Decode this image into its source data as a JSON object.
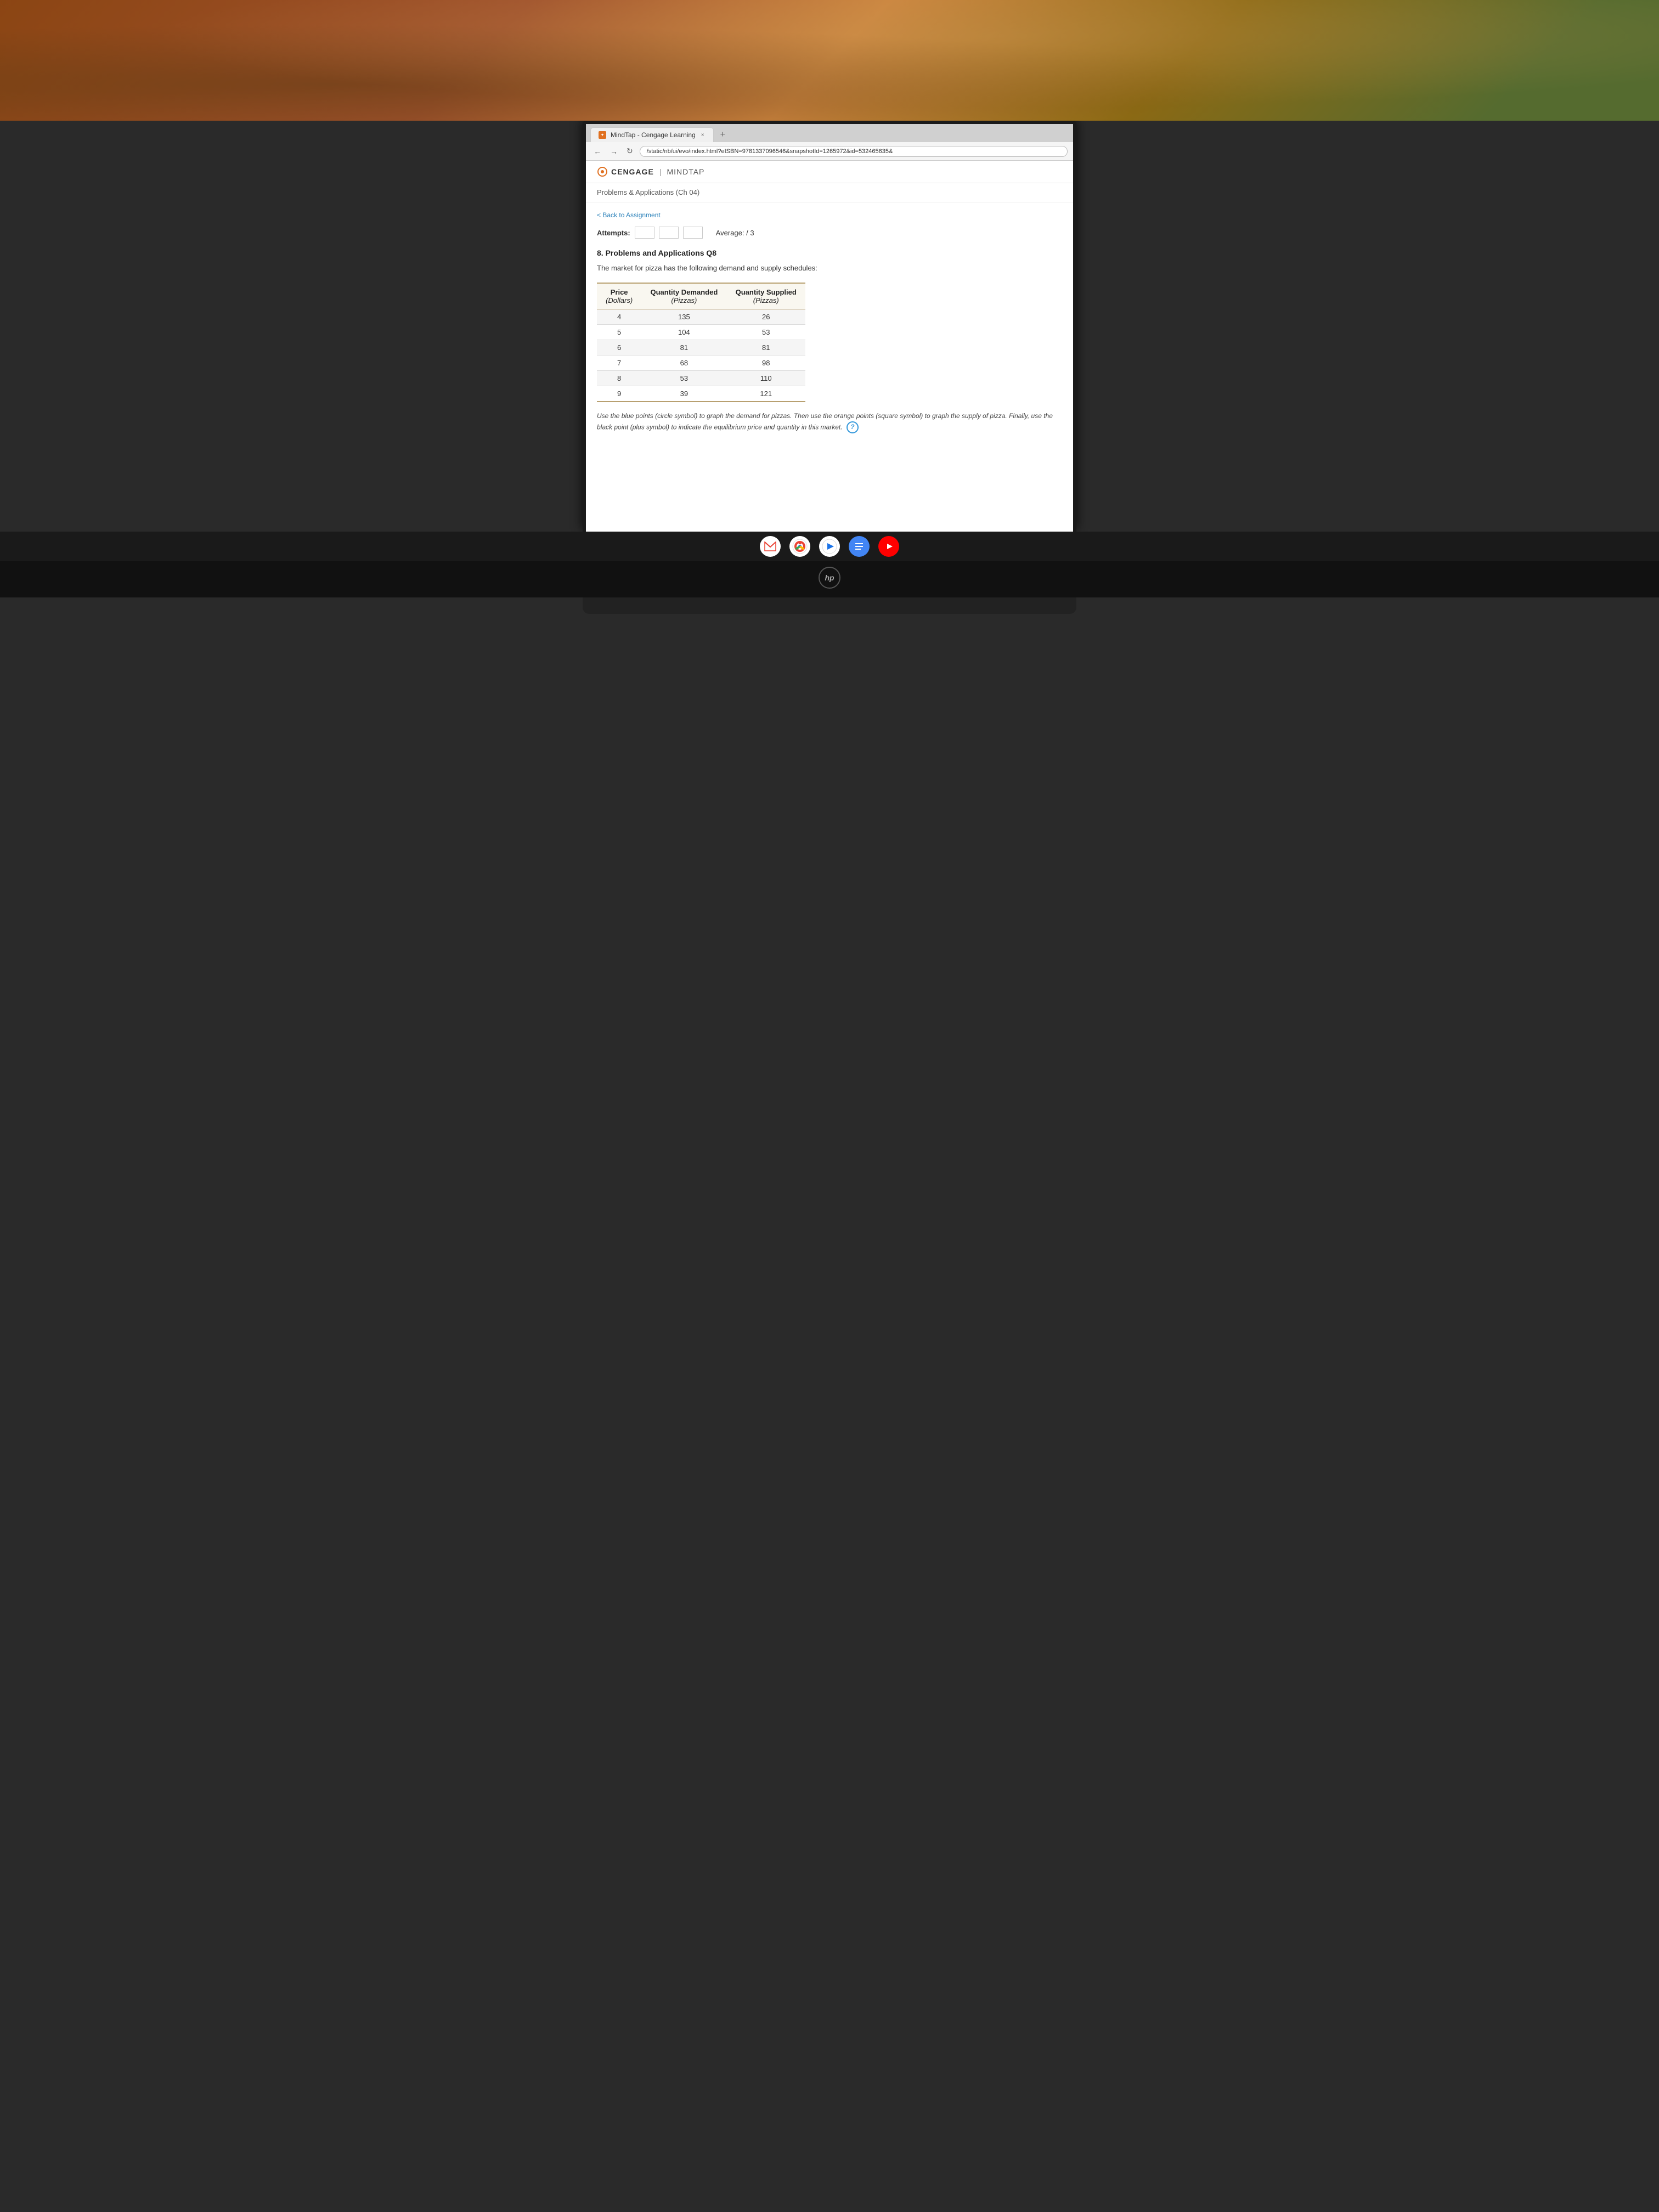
{
  "browser": {
    "tab_label": "MindTap - Cengage Learning",
    "tab_close": "×",
    "new_tab": "+",
    "address_bar_url": "/static/nb/ui/evo/index.html?eISBN=9781337096546&snapshotId=1265972&id=532465635&",
    "nav_back": "←",
    "nav_forward": "→",
    "nav_refresh": "↻"
  },
  "header": {
    "logo_cengage": "CENGAGE",
    "logo_divider": "|",
    "logo_mindtap": "MINDTAP"
  },
  "breadcrumb": {
    "title": "Problems & Applications (Ch 04)"
  },
  "back_link": "< Back to Assignment",
  "attempts": {
    "label": "Attempts:",
    "boxes": [
      "",
      "",
      ""
    ],
    "average_label": "Average:",
    "average_value": "/ 3"
  },
  "question": {
    "number": "8.",
    "title": "8. Problems and Applications Q8",
    "body": "The market for pizza has the following demand and supply schedules:"
  },
  "table": {
    "headers": [
      {
        "line1": "Price",
        "line2": "(Dollars)"
      },
      {
        "line1": "Quantity Demanded",
        "line2": "(Pizzas)"
      },
      {
        "line1": "Quantity Supplied",
        "line2": "(Pizzas)"
      }
    ],
    "rows": [
      {
        "price": "4",
        "demanded": "135",
        "supplied": "26"
      },
      {
        "price": "5",
        "demanded": "104",
        "supplied": "53"
      },
      {
        "price": "6",
        "demanded": "81",
        "supplied": "81"
      },
      {
        "price": "7",
        "demanded": "68",
        "supplied": "98"
      },
      {
        "price": "8",
        "demanded": "53",
        "supplied": "110"
      },
      {
        "price": "9",
        "demanded": "39",
        "supplied": "121"
      }
    ]
  },
  "instructions": {
    "text": "Use the blue points (circle symbol) to graph the demand for pizzas. Then use the orange points (square symbol) to graph the supply of pizza. Finally, use the black point (plus symbol) to indicate the equilibrium price and quantity in this market."
  },
  "help_icon": "?",
  "taskbar": {
    "icons": [
      {
        "name": "gmail",
        "label": "M"
      },
      {
        "name": "chrome",
        "label": ""
      },
      {
        "name": "play",
        "label": "▶"
      },
      {
        "name": "docs",
        "label": "≡"
      },
      {
        "name": "youtube",
        "label": "▶"
      }
    ]
  },
  "hp_logo": "hp"
}
